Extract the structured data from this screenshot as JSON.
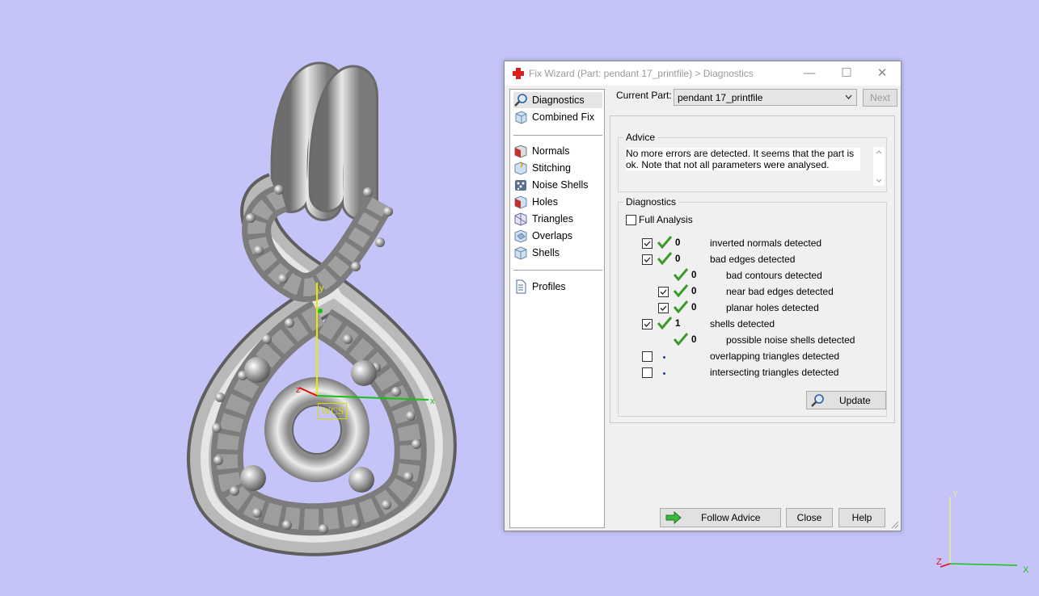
{
  "viewport": {
    "wcs_label": "WCS",
    "background": "#c4c4f8",
    "corner_axes": {
      "x": "X",
      "y": "Y",
      "z": "Z"
    }
  },
  "window": {
    "title": "Fix Wizard (Part: pendant 17_printfile) > Diagnostics"
  },
  "nav": {
    "group1": [
      {
        "label": "Diagnostics",
        "icon": "magnifier-icon",
        "active": true
      },
      {
        "label": "Combined Fix",
        "icon": "cube-icon"
      }
    ],
    "group2": [
      {
        "label": "Normals",
        "icon": "normals-icon"
      },
      {
        "label": "Stitching",
        "icon": "stitching-icon"
      },
      {
        "label": "Noise Shells",
        "icon": "noise-shells-icon"
      },
      {
        "label": "Holes",
        "icon": "holes-icon"
      },
      {
        "label": "Triangles",
        "icon": "triangles-icon"
      },
      {
        "label": "Overlaps",
        "icon": "overlaps-icon"
      },
      {
        "label": "Shells",
        "icon": "shells-icon"
      }
    ],
    "group3": [
      {
        "label": "Profiles",
        "icon": "document-icon"
      }
    ]
  },
  "current_part": {
    "label": "Current Part:",
    "value": "pendant 17_printfile",
    "next_label": "Next"
  },
  "advice": {
    "title": "Advice",
    "text": "No more errors are detected. It seems that the part is ok. Note that not all parameters were analysed."
  },
  "diagnostics": {
    "title": "Diagnostics",
    "full_analysis_label": "Full Analysis",
    "rows": [
      {
        "count": "0",
        "label": "inverted normals detected"
      },
      {
        "count": "0",
        "label": "bad edges detected"
      },
      {
        "count": "0",
        "label": "bad contours detected"
      },
      {
        "count": "0",
        "label": "near bad edges detected"
      },
      {
        "count": "0",
        "label": "planar holes detected"
      },
      {
        "count": "1",
        "label": "shells detected"
      },
      {
        "count": "0",
        "label": "possible noise shells detected"
      },
      {
        "count": "",
        "label": "overlapping triangles detected"
      },
      {
        "count": "",
        "label": "intersecting triangles detected"
      }
    ],
    "update_label": "Update"
  },
  "footer": {
    "follow_advice_label": "Follow Advice",
    "close_label": "Close",
    "help_label": "Help"
  },
  "colors": {
    "check_green": "#3a9a2a",
    "accent_red": "#d81e1e"
  }
}
